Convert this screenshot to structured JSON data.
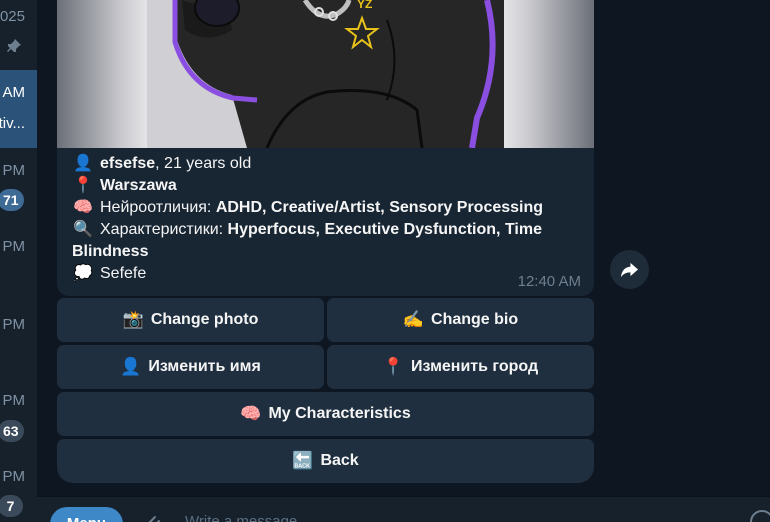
{
  "chat_list": {
    "items": [
      {
        "time": "025",
        "badge": ""
      },
      {
        "time": "AM",
        "preview": "tiv..."
      },
      {
        "time": "PM",
        "badge": "71"
      },
      {
        "time": "PM",
        "badge": ""
      },
      {
        "time": "PM",
        "badge": ""
      },
      {
        "time": "PM",
        "badge": "63"
      },
      {
        "time": "PM",
        "badge": "7"
      }
    ]
  },
  "message": {
    "photo_text": "YZ",
    "name": "efsefse",
    "age_text": ", 21 years old",
    "city": "Warszawa",
    "neuro_label": "Нейроотличия: ",
    "neuro_value": "ADHD, Creative/Artist, Sensory Processing",
    "traits_label": "Характеристики: ",
    "traits_value": "Hyperfocus, Executive Dysfunction, Time Blindness",
    "bio": "Sefefe",
    "time": "12:40 AM",
    "icons": {
      "user": "👤",
      "pin": "📍",
      "brain": "🧠",
      "search": "🔍",
      "thought": "💭"
    }
  },
  "keyboard": {
    "change_photo": {
      "icon": "📸",
      "label": "Change photo"
    },
    "change_bio": {
      "icon": "✍",
      "label": "Change bio"
    },
    "change_name": {
      "icon": "👤",
      "label": "Изменить имя"
    },
    "change_city": {
      "icon": "📍",
      "label": "Изменить город"
    },
    "characteristics": {
      "icon": "🧠",
      "label": "My Characteristics"
    },
    "back": {
      "icon": "🔙",
      "label": "Back"
    }
  },
  "composer": {
    "menu_label": "Menu",
    "placeholder": "Write a message..."
  },
  "colors": {
    "background": "#0e1621",
    "bubble": "#182533",
    "button": "#1f2f3f",
    "accent": "#3e88c7"
  }
}
